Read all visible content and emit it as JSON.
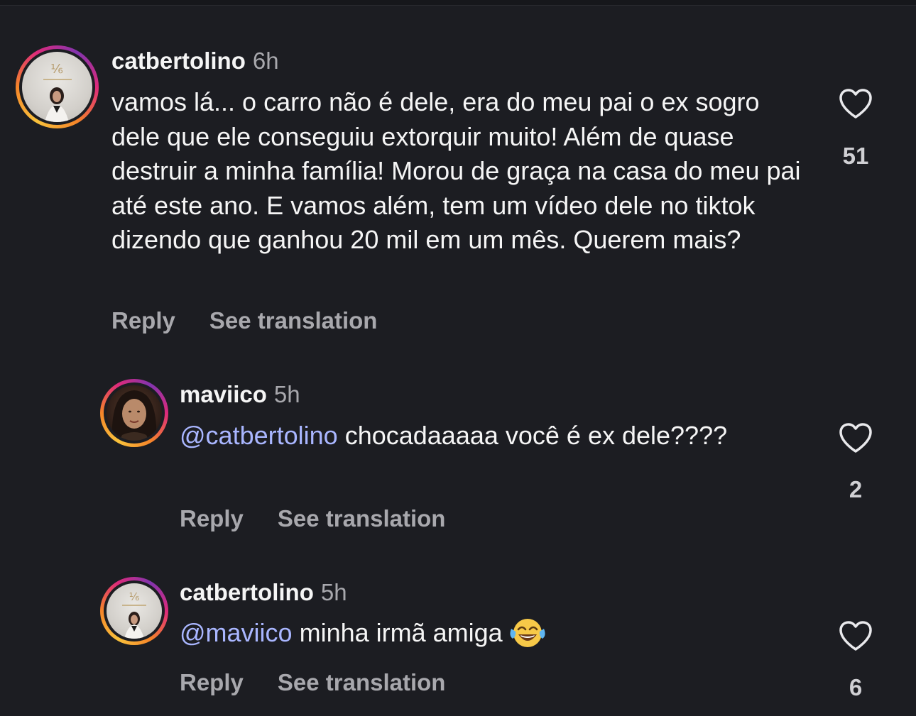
{
  "comments": [
    {
      "username": "catbertolino",
      "time": "6h",
      "mention": "",
      "text": "vamos lá... o carro não é dele, era do meu pai o ex sogro dele que ele conseguiu extorquir muito! Além de quase destruir a minha família! Morou de graça na casa do meu pai até este ano. E vamos além, tem um vídeo dele no tiktok dizendo que ganhou 20 mil em um mês. Querem mais?",
      "likes": "51",
      "reply_label": "Reply",
      "translate_label": "See translation",
      "avatar_icon": "profile-photo-woman-icon"
    },
    {
      "username": "maviico",
      "time": "5h",
      "mention": "@catbertolino",
      "text": "chocadaaaaa você é ex dele????",
      "likes": "2",
      "reply_label": "Reply",
      "translate_label": "See translation",
      "avatar_icon": "profile-photo-selfie-icon"
    },
    {
      "username": "catbertolino",
      "time": "5h",
      "mention": "@maviico",
      "text": "minha irmã amiga",
      "emoji": "face-with-tears-of-joy-emoji",
      "likes": "6",
      "reply_label": "Reply",
      "translate_label": "See translation",
      "avatar_icon": "profile-photo-woman-icon"
    }
  ],
  "colors": {
    "background": "#1c1d22",
    "text": "#f5f5f5",
    "secondary": "#a8a8ad",
    "mention": "#a9b6ff"
  }
}
